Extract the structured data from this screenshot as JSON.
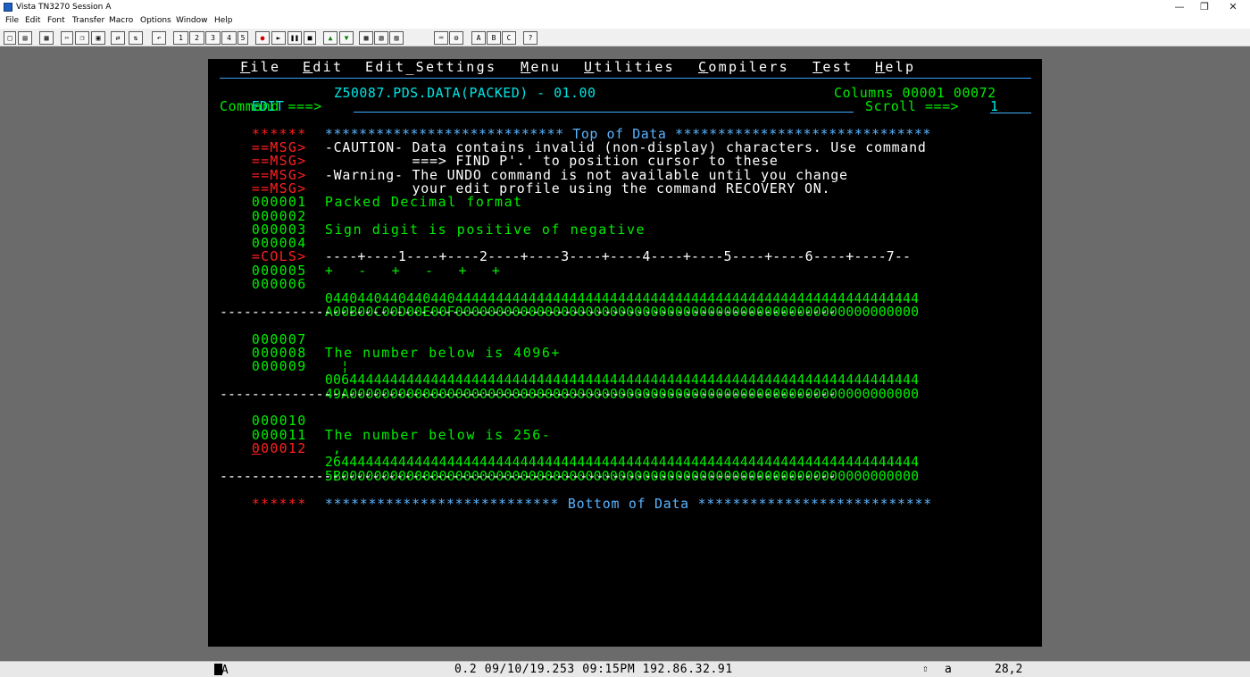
{
  "window": {
    "title": "Vista TN3270 Session A"
  },
  "menubar": [
    "File",
    "Edit",
    "Font",
    "Transfer",
    "Macro",
    "Options",
    "Window",
    "Help"
  ],
  "toolbar": {
    "run_labels": [
      "1",
      "2",
      "3",
      "4",
      "5"
    ],
    "abc_labels": [
      "A",
      "B",
      "C"
    ],
    "help_label": "?"
  },
  "terminal": {
    "action_bar": [
      {
        "u": "F",
        "rest": "ile"
      },
      {
        "u": "E",
        "rest": "dit"
      },
      {
        "u": "",
        "rest": "Edit_Settings"
      },
      {
        "u": "M",
        "rest": "enu"
      },
      {
        "u": "U",
        "rest": "tilities"
      },
      {
        "u": "C",
        "rest": "ompilers"
      },
      {
        "u": "T",
        "rest": "est"
      },
      {
        "u": "H",
        "rest": "elp"
      }
    ],
    "header": {
      "mode": "EDIT",
      "dataset": "Z50087.PDS.DATA(PACKED) - 01.00",
      "columns": "Columns 00001 00072",
      "command_label": "Command ===>",
      "scroll_label": "Scroll ===>",
      "scroll_value": "1"
    },
    "top_prefix": "******",
    "top_of_data": "**************************** Top of Data ******************************",
    "messages": [
      {
        "prefix": "==MSG>",
        "text": "-CAUTION- Data contains invalid (non-display) characters. Use command"
      },
      {
        "prefix": "==MSG>",
        "text": "          ===> FIND P'.' to position cursor to these"
      },
      {
        "prefix": "==MSG>",
        "text": "-Warning- The UNDO command is not available until you change"
      },
      {
        "prefix": "==MSG>",
        "text": "          your edit profile using the command RECOVERY ON."
      }
    ],
    "lines_a": [
      {
        "num": "000001",
        "text": "Packed Decimal format"
      },
      {
        "num": "000002",
        "text": ""
      },
      {
        "num": "000003",
        "text": "Sign digit is positive of negative"
      },
      {
        "num": "000004",
        "text": ""
      }
    ],
    "cols_prefix": "=COLS>",
    "cols_ruler": "----+----1----+----2----+----3----+----4----+----5----+----6----+----7--",
    "line5": {
      "num": "000005",
      "text": "+  -  +  -  +  +"
    },
    "line6": {
      "num": "000006",
      "text": ""
    },
    "hex6": {
      "zone": "0440440440440440444444444444444444444444444444444444444444444444444444444",
      "digit": "A00B00C00D00E00F000000000000000000000000000000000000000000000000000000000"
    },
    "dashes": "-----------------------------------------------------------------------------",
    "line7": {
      "num": "000007",
      "text": ""
    },
    "line8": {
      "num": "000008",
      "text": "The number below is 4096+"
    },
    "line9": {
      "num": "000009",
      "text": "  ¦"
    },
    "hex9": {
      "zone": "0064444444444444444444444444444444444444444444444444444444444444444444444",
      "digit": "49A0000000000000000000000000000000000000000000000000000000000000000000000"
    },
    "line10": {
      "num": "000010",
      "text": ""
    },
    "line11": {
      "num": "000011",
      "text": "The number below is 256-"
    },
    "line12": {
      "num_cursor": "0",
      "num_rest": "00012",
      "text": " ,"
    },
    "hex12": {
      "zone": "2644444444444444444444444444444444444444444444444444444444444444444444444",
      "digit": "5B00000000000000000000000000000000000000000000000000000000000000000000000"
    },
    "bottom_prefix": "******",
    "bottom_of_data": "*************************** Bottom of Data ***************************"
  },
  "statusbar": {
    "mode": "MA",
    "info": "0.2 09/10/19.253 09:15PM 192.86.32.91",
    "indicator": "a",
    "cursor_pos": "28,2"
  }
}
